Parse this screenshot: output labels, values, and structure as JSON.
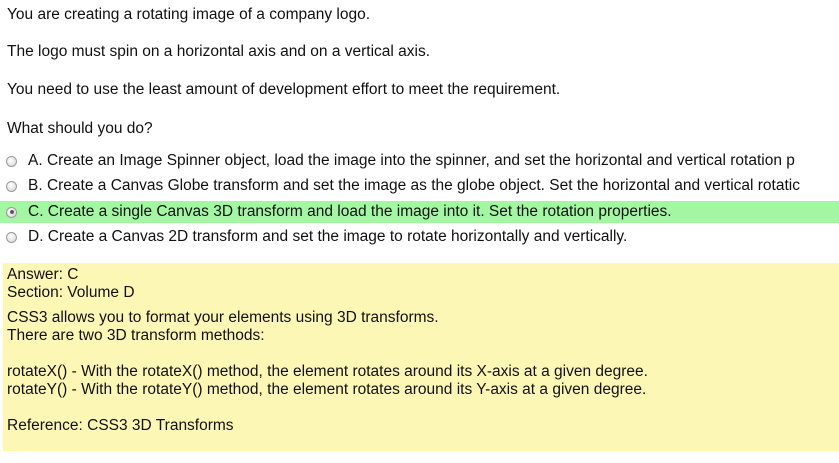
{
  "question": {
    "lines": [
      "You are creating a rotating image of a company logo.",
      "The logo must spin on a horizontal axis and on a vertical axis.",
      "You need to use the least amount of development effort to meet the requirement.",
      "What should you do?"
    ]
  },
  "options": [
    {
      "text": "A. Create an Image Spinner object, load the image into the spinner, and set the horizontal and vertical rotation p",
      "selected": false
    },
    {
      "text": "B. Create a Canvas Globe transform and set the image as the globe object. Set the horizontal and vertical rotatic",
      "selected": false
    },
    {
      "text": "C. Create a single Canvas 3D transform and load the image into it. Set the rotation properties.",
      "selected": true
    },
    {
      "text": "D. Create a Canvas 2D transform and set the image to rotate horizontally and vertically.",
      "selected": false
    }
  ],
  "answer": {
    "answer_line": "Answer: C",
    "section_line": "Section: Volume D",
    "explanation_1": "CSS3 allows you to format your elements using 3D transforms.",
    "explanation_2": "There are two 3D transform methods:",
    "method_x": "rotateX() - With the rotateX() method, the element rotates around its X-axis at a given degree.",
    "method_y": "rotateY() - With the rotateY() method, the element rotates around its Y-axis at a given degree.",
    "reference": "Reference: CSS3 3D Transforms"
  },
  "colors": {
    "selected_highlight": "#a3f7a3",
    "answer_background": "#fdf7b5"
  }
}
